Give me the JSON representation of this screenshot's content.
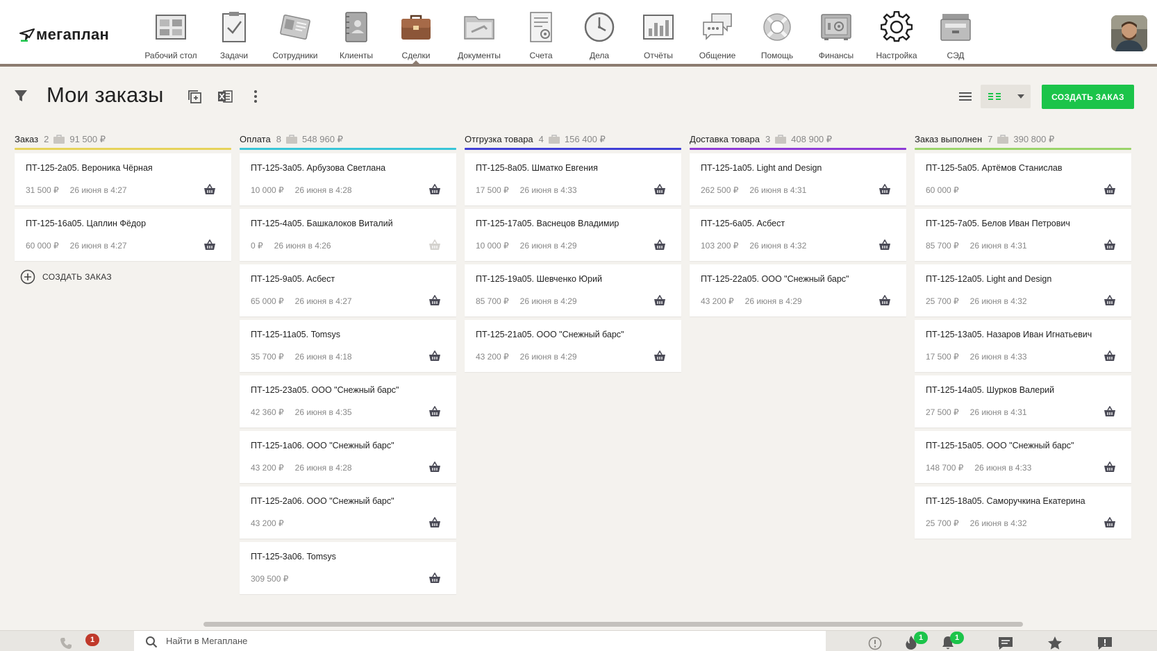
{
  "app": {
    "logo_text": "мегаплан"
  },
  "nav": [
    {
      "label": "Рабочий стол",
      "icon": "desktop-icon"
    },
    {
      "label": "Задачи",
      "icon": "tasks-icon"
    },
    {
      "label": "Сотрудники",
      "icon": "employees-icon"
    },
    {
      "label": "Клиенты",
      "icon": "clients-icon"
    },
    {
      "label": "Сделки",
      "icon": "deals-icon",
      "active": true
    },
    {
      "label": "Документы",
      "icon": "documents-icon"
    },
    {
      "label": "Счета",
      "icon": "invoices-icon"
    },
    {
      "label": "Дела",
      "icon": "clock-icon"
    },
    {
      "label": "Отчёты",
      "icon": "reports-icon"
    },
    {
      "label": "Общение",
      "icon": "chat-icon"
    },
    {
      "label": "Помощь",
      "icon": "lifebuoy-icon"
    },
    {
      "label": "Финансы",
      "icon": "safe-icon"
    },
    {
      "label": "Настройка",
      "icon": "gear-icon"
    },
    {
      "label": "СЭД",
      "icon": "edms-icon"
    }
  ],
  "toolbar": {
    "title": "Мои заказы",
    "create_button": "СОЗДАТЬ ЗАКАЗ"
  },
  "colors": {
    "accent": "#1bc44a",
    "nav_border": "#8c7c70",
    "badge_red": "#c0392b"
  },
  "columns": [
    {
      "title": "Заказ",
      "count": "2",
      "sum": "91 500 ₽",
      "color": "#e6d35a",
      "create_label": "СОЗДАТЬ ЗАКАЗ",
      "cards": [
        {
          "title": "ПТ-125-2а05. Вероника Чёрная",
          "amount": "31 500 ₽",
          "date": "26 июня в 4:27"
        },
        {
          "title": "ПТ-125-16а05. Цаплин Фёдор",
          "amount": "60 000 ₽",
          "date": "26 июня в 4:27"
        }
      ]
    },
    {
      "title": "Оплата",
      "count": "8",
      "sum": "548 960 ₽",
      "color": "#38c5d8",
      "cards": [
        {
          "title": "ПТ-125-3а05. Арбузова Светлана",
          "amount": "10 000 ₽",
          "date": "26 июня в 4:28"
        },
        {
          "title": "ПТ-125-4а05. Башкалоков Виталий",
          "amount": "0 ₽",
          "date": "26 июня в 4:26",
          "faded": true
        },
        {
          "title": "ПТ-125-9а05. Асбест",
          "amount": "65 000 ₽",
          "date": "26 июня в 4:27"
        },
        {
          "title": "ПТ-125-11а05. Tomsys",
          "amount": "35 700 ₽",
          "date": "26 июня в 4:18"
        },
        {
          "title": "ПТ-125-23а05. ООО \"Снежный барс\"",
          "amount": "42 360 ₽",
          "date": "26 июня в 4:35"
        },
        {
          "title": "ПТ-125-1а06. ООО \"Снежный барс\"",
          "amount": "43 200 ₽",
          "date": "26 июня в 4:28"
        },
        {
          "title": "ПТ-125-2а06. ООО \"Снежный барс\"",
          "amount": "43 200 ₽",
          "date": ""
        },
        {
          "title": "ПТ-125-3а06. Tomsys",
          "amount": "309 500 ₽",
          "date": ""
        }
      ]
    },
    {
      "title": "Отгрузка товара",
      "count": "4",
      "sum": "156 400 ₽",
      "color": "#3f3fd6",
      "cards": [
        {
          "title": "ПТ-125-8а05. Шматко Евгения",
          "amount": "17 500 ₽",
          "date": "26 июня в 4:33"
        },
        {
          "title": "ПТ-125-17а05. Васнецов Владимир",
          "amount": "10 000 ₽",
          "date": "26 июня в 4:29"
        },
        {
          "title": "ПТ-125-19а05. Шевченко Юрий",
          "amount": "85 700 ₽",
          "date": "26 июня в 4:29"
        },
        {
          "title": "ПТ-125-21а05. ООО \"Снежный барс\"",
          "amount": "43 200 ₽",
          "date": "26 июня в 4:29"
        }
      ]
    },
    {
      "title": "Доставка товара",
      "count": "3",
      "sum": "408 900 ₽",
      "color": "#8e3bd6",
      "cards": [
        {
          "title": "ПТ-125-1а05. Light and Design",
          "amount": "262 500 ₽",
          "date": "26 июня в 4:31"
        },
        {
          "title": "ПТ-125-6а05. Асбест",
          "amount": "103 200 ₽",
          "date": "26 июня в 4:32"
        },
        {
          "title": "ПТ-125-22а05. ООО \"Снежный барс\"",
          "amount": "43 200 ₽",
          "date": "26 июня в 4:29"
        }
      ]
    },
    {
      "title": "Заказ выполнен",
      "count": "7",
      "sum": "390 800 ₽",
      "color": "#9ad46a",
      "cards": [
        {
          "title": "ПТ-125-5а05. Артёмов Станислав",
          "amount": "60 000 ₽",
          "date": ""
        },
        {
          "title": "ПТ-125-7а05. Белов Иван Петрович",
          "amount": "85 700 ₽",
          "date": "26 июня в 4:31"
        },
        {
          "title": "ПТ-125-12а05. Light and Design",
          "amount": "25 700 ₽",
          "date": "26 июня в 4:32"
        },
        {
          "title": "ПТ-125-13а05. Назаров Иван Игнатьевич",
          "amount": "17 500 ₽",
          "date": "26 июня в 4:33"
        },
        {
          "title": "ПТ-125-14а05. Шурков Валерий",
          "amount": "27 500 ₽",
          "date": "26 июня в 4:31"
        },
        {
          "title": "ПТ-125-15а05. ООО \"Снежный барс\"",
          "amount": "148 700 ₽",
          "date": "26 июня в 4:33"
        },
        {
          "title": "ПТ-125-18а05. Саморучкина Екатерина",
          "amount": "25 700 ₽",
          "date": "26 июня в 4:32"
        }
      ]
    }
  ],
  "bottom": {
    "search_placeholder": "Найти в Мегаплане",
    "phone_badge": "1",
    "fire_badge": "1",
    "bell_badge": "1"
  }
}
